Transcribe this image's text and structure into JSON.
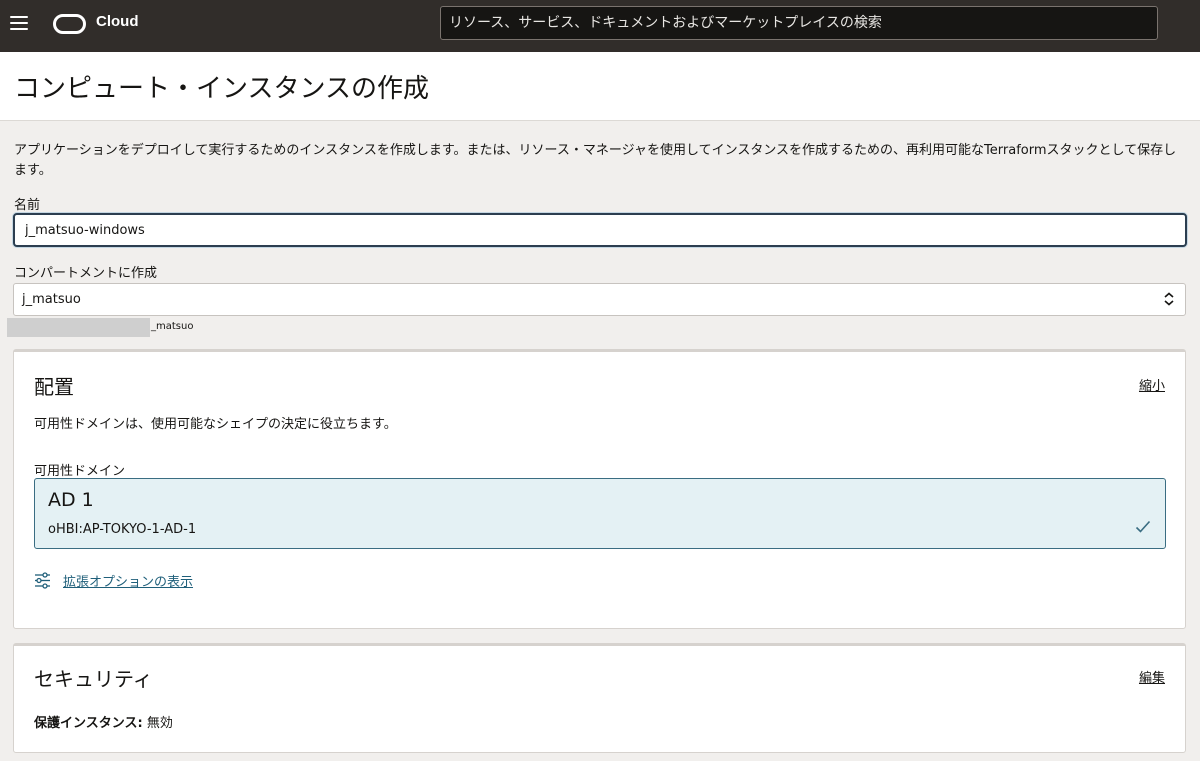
{
  "header": {
    "brand": "Cloud",
    "search_placeholder": "リソース、サービス、ドキュメントおよびマーケットプレイスの検索"
  },
  "page": {
    "title": "コンピュート・インスタンスの作成",
    "description": "アプリケーションをデプロイして実行するためのインスタンスを作成します。または、リソース・マネージャを使用してインスタンスを作成するための、再利用可能なTerraformスタックとして保存します。"
  },
  "form": {
    "name_label": "名前",
    "name_value": "j_matsuo-windows",
    "compartment_label": "コンパートメントに作成",
    "compartment_value": "j_matsuo",
    "compartment_path_suffix": "_matsuo"
  },
  "placement": {
    "title": "配置",
    "collapse_label": "縮小",
    "description": "可用性ドメインは、使用可能なシェイプの決定に役立ちます。",
    "ad_label": "可用性ドメイン",
    "ad_name": "AD 1",
    "ad_id": "oHBI:AP-TOKYO-1-AD-1",
    "advanced_link": "拡張オプションの表示"
  },
  "security": {
    "title": "セキュリティ",
    "edit_label": "編集",
    "shielded_label": "保護インスタンス:",
    "shielded_value": "無効"
  },
  "colors": {
    "header_bg": "#312d2a",
    "page_bg": "#f1efed",
    "selected_tile_bg": "#e4f1f4",
    "selected_tile_border": "#3a6d82",
    "link": "#1f5f7a"
  }
}
